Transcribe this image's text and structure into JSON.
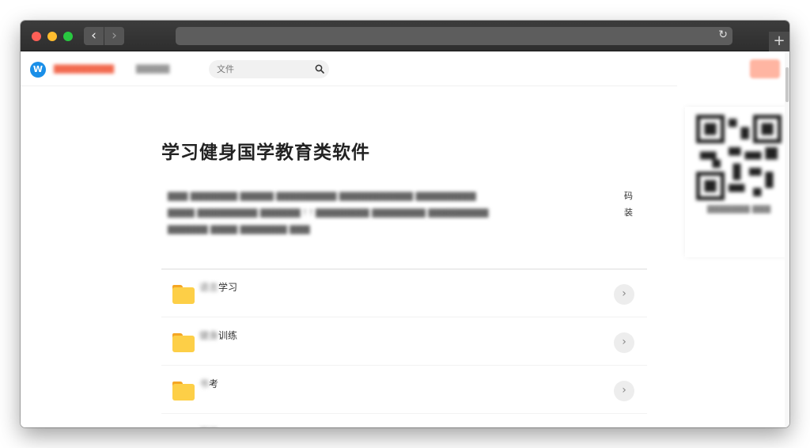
{
  "search": {
    "placeholder": "文件"
  },
  "main": {
    "title": "学习健身国学教育类软件",
    "desc_end_1": "码",
    "desc_end_2": "装"
  },
  "folders": [
    {
      "label_hidden": "语言",
      "label": "学习"
    },
    {
      "label_hidden": "健身",
      "label": "训练"
    },
    {
      "label_hidden": "书",
      "label": "考"
    },
    {
      "label_hidden": "国",
      "label": "学"
    }
  ],
  "icons": {
    "search": "search-icon",
    "folder": "folder-icon",
    "chevron": "chevron-right-icon",
    "back": "chevron-left-icon",
    "forward": "chevron-right-icon",
    "reload": "reload-icon",
    "new_tab": "plus-icon"
  },
  "colors": {
    "accent": "#f26a4f",
    "logo": "#1a8fe8",
    "folder": "#fdcf47"
  }
}
